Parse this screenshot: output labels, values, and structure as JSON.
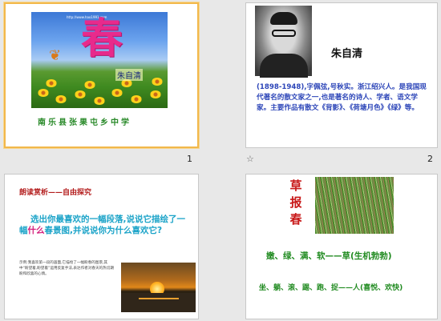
{
  "slides": [
    {
      "number": "1",
      "selected": true,
      "url": "http://www.hao1991.com",
      "title_char": "春",
      "author": "朱自清",
      "caption": "南乐县张果屯乡中学"
    },
    {
      "number": "2",
      "name": "朱自清",
      "bio": "(1898-1948),字佩弦,号秋实。浙江绍兴人。是我国现代著名的散文家之一,也是著名的诗人、学者、语文学家。主要作品有散文《背影》、《荷塘月色》《绿》等。"
    },
    {
      "number": "",
      "title": "朗读赏析——自由探究",
      "body_before": "选出你最喜欢的一幅段落,说说它描绘了一幅",
      "body_highlight": "什么",
      "body_after": "春景图,并说说你为什么喜欢它?",
      "note": "示例:我喜欢第一段的画面,它描绘了一幅盼春的图景,其中“盼望着,盼望着”运用反复手法,表达作者对春天的热切期盼和欣喜的心情。"
    },
    {
      "number": "",
      "vertical_title": "草报春",
      "line1": "嫩、绿、满、软——草(生机勃勃)",
      "line2": "坐、躺、滚、踢、跑、捉——人(喜悦、欢快)"
    }
  ],
  "labels": {
    "slide1_number": "1",
    "slide2_number": "2",
    "animation_marker": "☆"
  },
  "colors": {
    "selection": "#f2b84b",
    "title_pink": "#e82a8c",
    "bio_blue": "#2b44b8",
    "green_text": "#1f8a1f",
    "red_title": "#c81818"
  }
}
